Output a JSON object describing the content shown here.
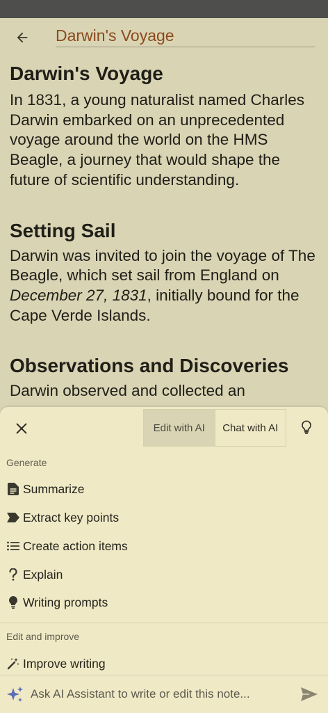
{
  "header": {
    "title": "Darwin's Voyage"
  },
  "note": {
    "sections": [
      {
        "heading": "Darwin's Voyage",
        "body": "In 1831, a young naturalist named Charles Darwin embarked on an unprecedented voyage around the world on the HMS Beagle, a journey that would shape the future of scientific understanding."
      },
      {
        "heading": "Setting Sail",
        "body_pre": "Darwin was invited to join the voyage of The Beagle, which set sail from England on ",
        "body_em": "December 27, 1831",
        "body_post": ", initially bound for the Cape Verde Islands."
      },
      {
        "heading": "Observations and Discoveries",
        "body": "Darwin observed and collected an"
      }
    ]
  },
  "sheet": {
    "tabs": {
      "edit": "Edit with AI",
      "chat": "Chat with AI"
    },
    "generate_label": "Generate",
    "generate_items": [
      {
        "label": "Summarize",
        "icon": "summary-doc-icon"
      },
      {
        "label": "Extract key points",
        "icon": "label-tag-icon"
      },
      {
        "label": "Create action items",
        "icon": "list-icon"
      },
      {
        "label": "Explain",
        "icon": "question-mark-icon"
      },
      {
        "label": "Writing prompts",
        "icon": "lightbulb-icon"
      }
    ],
    "edit_label": "Edit and improve",
    "edit_items": [
      {
        "label": "Improve writing",
        "icon": "magic-wand-icon"
      }
    ]
  },
  "input": {
    "placeholder": "Ask AI Assistant to write or edit this note..."
  },
  "colors": {
    "background": "#d9d4b4",
    "sheet": "#efe9c6",
    "title": "#8b4a1d",
    "ai_accent": "#5a6db5"
  }
}
